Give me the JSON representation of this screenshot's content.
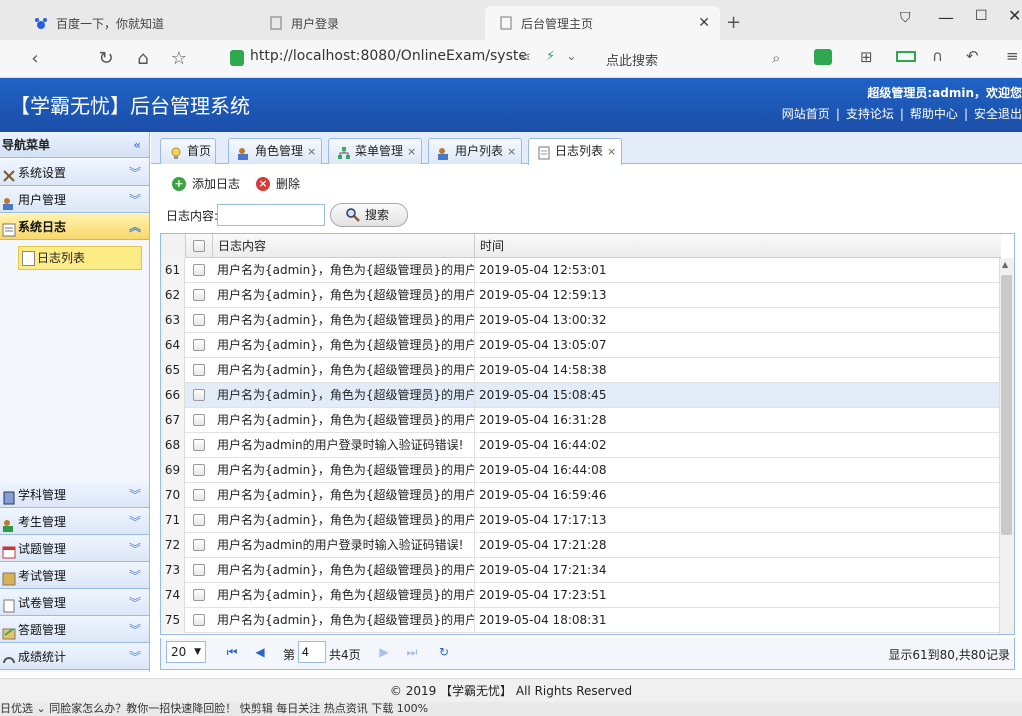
{
  "browser": {
    "tabs": [
      {
        "title": "百度一下，你就知道"
      },
      {
        "title": "用户登录"
      },
      {
        "title": "后台管理主页"
      }
    ],
    "url": "http://localhost:8080/OnlineExam/syste",
    "search_hint": "点此搜索"
  },
  "header": {
    "title": "【学霸无忧】后台管理系统",
    "welcome": "超级管理员:admin，欢迎您",
    "links": [
      "网站首页",
      "支持论坛",
      "帮助中心",
      "安全退出"
    ]
  },
  "sidebar": {
    "title": "导航菜单",
    "groups_top": [
      {
        "label": "系统设置",
        "icon": "tools-icon"
      },
      {
        "label": "用户管理",
        "icon": "users-icon"
      },
      {
        "label": "系统日志",
        "icon": "log-icon",
        "active": true
      }
    ],
    "sub_item": "日志列表",
    "groups_bottom": [
      {
        "label": "学科管理",
        "icon": "book-icon"
      },
      {
        "label": "考生管理",
        "icon": "students-icon"
      },
      {
        "label": "试题管理",
        "icon": "calendar-icon"
      },
      {
        "label": "考试管理",
        "icon": "map-icon"
      },
      {
        "label": "试卷管理",
        "icon": "paper-icon"
      },
      {
        "label": "答题管理",
        "icon": "answer-icon"
      },
      {
        "label": "成绩统计",
        "icon": "headset-icon"
      }
    ]
  },
  "tabs": [
    {
      "label": "首页",
      "closable": false
    },
    {
      "label": "角色管理",
      "closable": true
    },
    {
      "label": "菜单管理",
      "closable": true
    },
    {
      "label": "用户列表",
      "closable": true
    },
    {
      "label": "日志列表",
      "closable": true,
      "selected": true
    }
  ],
  "toolbar": {
    "add_label": "添加日志",
    "delete_label": "删除"
  },
  "search": {
    "label": "日志内容:",
    "value": "",
    "button": "搜索"
  },
  "grid": {
    "columns": [
      "日志内容",
      "时间"
    ],
    "rows": [
      {
        "n": "61",
        "content": "用户名为{admin}，角色为{超级管理员}的用户登",
        "time": "2019-05-04 12:53:01"
      },
      {
        "n": "62",
        "content": "用户名为{admin}，角色为{超级管理员}的用户登",
        "time": "2019-05-04 12:59:13"
      },
      {
        "n": "63",
        "content": "用户名为{admin}，角色为{超级管理员}的用户登",
        "time": "2019-05-04 13:00:32"
      },
      {
        "n": "64",
        "content": "用户名为{admin}，角色为{超级管理员}的用户登",
        "time": "2019-05-04 13:05:07"
      },
      {
        "n": "65",
        "content": "用户名为{admin}，角色为{超级管理员}的用户登",
        "time": "2019-05-04 14:58:38"
      },
      {
        "n": "66",
        "content": "用户名为{admin}，角色为{超级管理员}的用户登",
        "time": "2019-05-04 15:08:45",
        "highlight": true
      },
      {
        "n": "67",
        "content": "用户名为{admin}，角色为{超级管理员}的用户登",
        "time": "2019-05-04 16:31:28"
      },
      {
        "n": "68",
        "content": "用户名为admin的用户登录时输入验证码错误!",
        "time": "2019-05-04 16:44:02"
      },
      {
        "n": "69",
        "content": "用户名为{admin}，角色为{超级管理员}的用户登",
        "time": "2019-05-04 16:44:08"
      },
      {
        "n": "70",
        "content": "用户名为{admin}，角色为{超级管理员}的用户登",
        "time": "2019-05-04 16:59:46"
      },
      {
        "n": "71",
        "content": "用户名为{admin}，角色为{超级管理员}的用户登",
        "time": "2019-05-04 17:17:13"
      },
      {
        "n": "72",
        "content": "用户名为admin的用户登录时输入验证码错误!",
        "time": "2019-05-04 17:21:28"
      },
      {
        "n": "73",
        "content": "用户名为{admin}，角色为{超级管理员}的用户登",
        "time": "2019-05-04 17:21:34"
      },
      {
        "n": "74",
        "content": "用户名为{admin}，角色为{超级管理员}的用户登",
        "time": "2019-05-04 17:23:51"
      },
      {
        "n": "75",
        "content": "用户名为{admin}，角色为{超级管理员}的用户登",
        "time": "2019-05-04 18:08:31"
      }
    ]
  },
  "pager": {
    "page_size": "20",
    "page_prefix": "第",
    "page_value": "4",
    "page_total": "共4页",
    "info": "显示61到80,共80记录"
  },
  "footer": "© 2019 【学霸无忧】 All Rights Reserved",
  "statusbar": "日优选    ⌄ 同脸家怎么办？教你一招快速降回脸！     快剪辑    每日关注    热点资讯        下载                100%",
  "colors": {
    "header_blue": "#1f63c6",
    "border_blue": "#99bbe8",
    "active_yellow": "#fbec88"
  }
}
